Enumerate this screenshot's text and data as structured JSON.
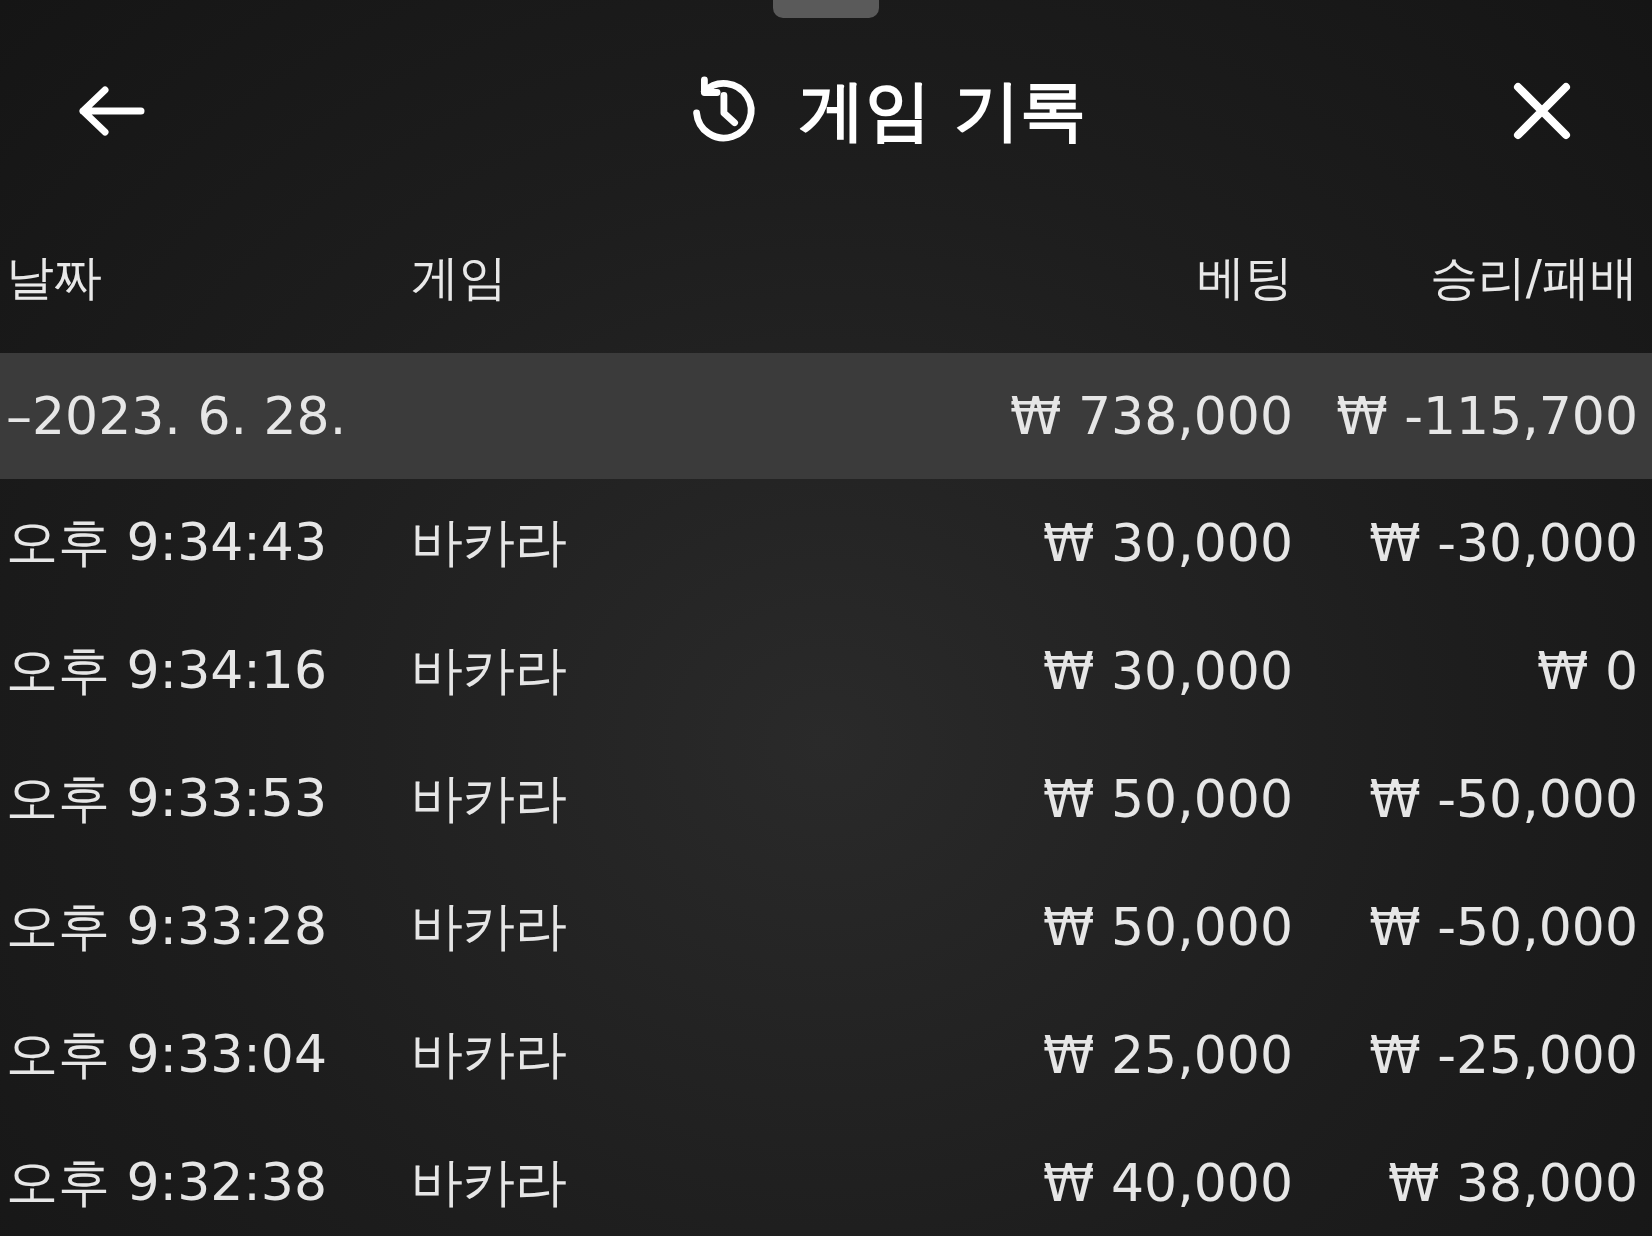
{
  "header": {
    "title": "게임 기록"
  },
  "columns": [
    "날짜",
    "게임",
    "베팅",
    "승리/패배"
  ],
  "date_group": {
    "date": "–2023. 6. 28.",
    "bet": "₩ 738,000",
    "result": "₩ -115,700"
  },
  "rows": [
    {
      "time": "오후 9:34:43",
      "game": "바카라",
      "bet": "₩ 30,000",
      "result": "₩ -30,000"
    },
    {
      "time": "오후 9:34:16",
      "game": "바카라",
      "bet": "₩ 30,000",
      "result": "₩ 0"
    },
    {
      "time": "오후 9:33:53",
      "game": "바카라",
      "bet": "₩ 50,000",
      "result": "₩ -50,000"
    },
    {
      "time": "오후 9:33:28",
      "game": "바카라",
      "bet": "₩ 50,000",
      "result": "₩ -50,000"
    },
    {
      "time": "오후 9:33:04",
      "game": "바카라",
      "bet": "₩ 25,000",
      "result": "₩ -25,000"
    },
    {
      "time": "오후 9:32:38",
      "game": "바카라",
      "bet": "₩ 40,000",
      "result": "₩ 38,000"
    }
  ]
}
